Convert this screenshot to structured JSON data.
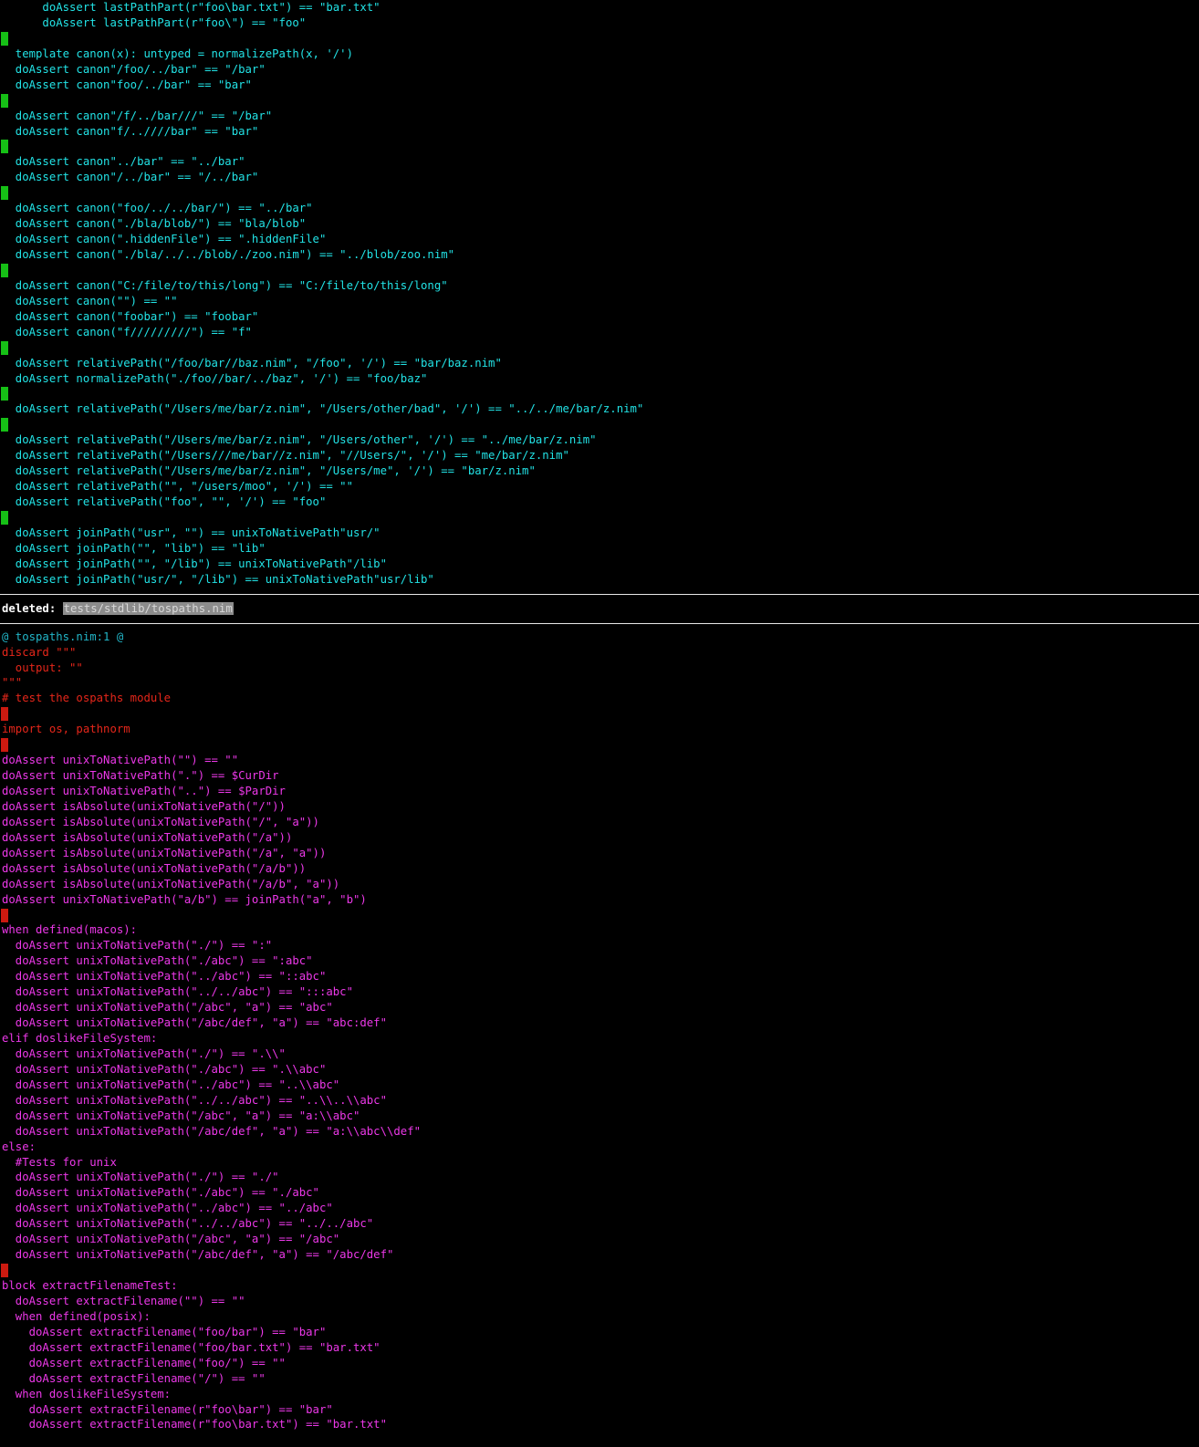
{
  "colors": {
    "background": "#000000",
    "added_text": "#22e3e6",
    "deleted_text": "#ec38e8",
    "deleted_context_text": "#e5261a",
    "hunk_header": "#22b6c8",
    "added_marker": "#16c016",
    "deleted_marker": "#cc1a10"
  },
  "added_block": {
    "lines": [
      {
        "type": "code",
        "text": "      doAssert lastPathPart(r\"foo\\bar.txt\") == \"bar.txt\""
      },
      {
        "type": "code",
        "text": "      doAssert lastPathPart(r\"foo\\\") == \"foo\""
      },
      {
        "type": "blank"
      },
      {
        "type": "code",
        "text": "  template canon(x): untyped = normalizePath(x, '/')"
      },
      {
        "type": "code",
        "text": "  doAssert canon\"/foo/../bar\" == \"/bar\""
      },
      {
        "type": "code",
        "text": "  doAssert canon\"foo/../bar\" == \"bar\""
      },
      {
        "type": "blank"
      },
      {
        "type": "code",
        "text": "  doAssert canon\"/f/../bar///\" == \"/bar\""
      },
      {
        "type": "code",
        "text": "  doAssert canon\"f/..////bar\" == \"bar\""
      },
      {
        "type": "blank"
      },
      {
        "type": "code",
        "text": "  doAssert canon\"../bar\" == \"../bar\""
      },
      {
        "type": "code",
        "text": "  doAssert canon\"/../bar\" == \"/../bar\""
      },
      {
        "type": "blank"
      },
      {
        "type": "code",
        "text": "  doAssert canon(\"foo/../../bar/\") == \"../bar\""
      },
      {
        "type": "code",
        "text": "  doAssert canon(\"./bla/blob/\") == \"bla/blob\""
      },
      {
        "type": "code",
        "text": "  doAssert canon(\".hiddenFile\") == \".hiddenFile\""
      },
      {
        "type": "code",
        "text": "  doAssert canon(\"./bla/../../blob/./zoo.nim\") == \"../blob/zoo.nim\""
      },
      {
        "type": "blank"
      },
      {
        "type": "code",
        "text": "  doAssert canon(\"C:/file/to/this/long\") == \"C:/file/to/this/long\""
      },
      {
        "type": "code",
        "text": "  doAssert canon(\"\") == \"\""
      },
      {
        "type": "code",
        "text": "  doAssert canon(\"foobar\") == \"foobar\""
      },
      {
        "type": "code",
        "text": "  doAssert canon(\"f/////////\") == \"f\""
      },
      {
        "type": "blank"
      },
      {
        "type": "code",
        "text": "  doAssert relativePath(\"/foo/bar//baz.nim\", \"/foo\", '/') == \"bar/baz.nim\""
      },
      {
        "type": "code",
        "text": "  doAssert normalizePath(\"./foo//bar/../baz\", '/') == \"foo/baz\""
      },
      {
        "type": "blank"
      },
      {
        "type": "code",
        "text": "  doAssert relativePath(\"/Users/me/bar/z.nim\", \"/Users/other/bad\", '/') == \"../../me/bar/z.nim\""
      },
      {
        "type": "blank"
      },
      {
        "type": "code",
        "text": "  doAssert relativePath(\"/Users/me/bar/z.nim\", \"/Users/other\", '/') == \"../me/bar/z.nim\""
      },
      {
        "type": "code",
        "text": "  doAssert relativePath(\"/Users///me/bar//z.nim\", \"//Users/\", '/') == \"me/bar/z.nim\""
      },
      {
        "type": "code",
        "text": "  doAssert relativePath(\"/Users/me/bar/z.nim\", \"/Users/me\", '/') == \"bar/z.nim\""
      },
      {
        "type": "code",
        "text": "  doAssert relativePath(\"\", \"/users/moo\", '/') == \"\""
      },
      {
        "type": "code",
        "text": "  doAssert relativePath(\"foo\", \"\", '/') == \"foo\""
      },
      {
        "type": "blank"
      },
      {
        "type": "code",
        "text": "  doAssert joinPath(\"usr\", \"\") == unixToNativePath\"usr/\""
      },
      {
        "type": "code",
        "text": "  doAssert joinPath(\"\", \"lib\") == \"lib\""
      },
      {
        "type": "code",
        "text": "  doAssert joinPath(\"\", \"/lib\") == unixToNativePath\"/lib\""
      },
      {
        "type": "code",
        "text": "  doAssert joinPath(\"usr/\", \"/lib\") == unixToNativePath\"usr/lib\""
      }
    ]
  },
  "file_header": {
    "label": "deleted: ",
    "path": "tests/stdlib/tospaths.nim"
  },
  "deleted_block": {
    "hunk": "@ tospaths.nim:1 @",
    "lines": [
      {
        "type": "ctx",
        "text": "discard \"\"\""
      },
      {
        "type": "ctx",
        "text": "  output: \"\""
      },
      {
        "type": "ctx",
        "text": "\"\"\""
      },
      {
        "type": "ctx",
        "text": "# test the ospaths module"
      },
      {
        "type": "blank"
      },
      {
        "type": "ctx",
        "text": "import os, pathnorm"
      },
      {
        "type": "blank"
      },
      {
        "type": "code",
        "text": "doAssert unixToNativePath(\"\") == \"\""
      },
      {
        "type": "code",
        "text": "doAssert unixToNativePath(\".\") == $CurDir"
      },
      {
        "type": "code",
        "text": "doAssert unixToNativePath(\"..\") == $ParDir"
      },
      {
        "type": "code",
        "text": "doAssert isAbsolute(unixToNativePath(\"/\"))"
      },
      {
        "type": "code",
        "text": "doAssert isAbsolute(unixToNativePath(\"/\", \"a\"))"
      },
      {
        "type": "code",
        "text": "doAssert isAbsolute(unixToNativePath(\"/a\"))"
      },
      {
        "type": "code",
        "text": "doAssert isAbsolute(unixToNativePath(\"/a\", \"a\"))"
      },
      {
        "type": "code",
        "text": "doAssert isAbsolute(unixToNativePath(\"/a/b\"))"
      },
      {
        "type": "code",
        "text": "doAssert isAbsolute(unixToNativePath(\"/a/b\", \"a\"))"
      },
      {
        "type": "code",
        "text": "doAssert unixToNativePath(\"a/b\") == joinPath(\"a\", \"b\")"
      },
      {
        "type": "blank"
      },
      {
        "type": "code",
        "text": "when defined(macos):"
      },
      {
        "type": "code",
        "text": "  doAssert unixToNativePath(\"./\") == \":\""
      },
      {
        "type": "code",
        "text": "  doAssert unixToNativePath(\"./abc\") == \":abc\""
      },
      {
        "type": "code",
        "text": "  doAssert unixToNativePath(\"../abc\") == \"::abc\""
      },
      {
        "type": "code",
        "text": "  doAssert unixToNativePath(\"../../abc\") == \":::abc\""
      },
      {
        "type": "code",
        "text": "  doAssert unixToNativePath(\"/abc\", \"a\") == \"abc\""
      },
      {
        "type": "code",
        "text": "  doAssert unixToNativePath(\"/abc/def\", \"a\") == \"abc:def\""
      },
      {
        "type": "code",
        "text": "elif doslikeFileSystem:"
      },
      {
        "type": "code",
        "text": "  doAssert unixToNativePath(\"./\") == \".\\\\\""
      },
      {
        "type": "code",
        "text": "  doAssert unixToNativePath(\"./abc\") == \".\\\\abc\""
      },
      {
        "type": "code",
        "text": "  doAssert unixToNativePath(\"../abc\") == \"..\\\\abc\""
      },
      {
        "type": "code",
        "text": "  doAssert unixToNativePath(\"../../abc\") == \"..\\\\..\\\\abc\""
      },
      {
        "type": "code",
        "text": "  doAssert unixToNativePath(\"/abc\", \"a\") == \"a:\\\\abc\""
      },
      {
        "type": "code",
        "text": "  doAssert unixToNativePath(\"/abc/def\", \"a\") == \"a:\\\\abc\\\\def\""
      },
      {
        "type": "code",
        "text": "else:"
      },
      {
        "type": "code",
        "text": "  #Tests for unix"
      },
      {
        "type": "code",
        "text": "  doAssert unixToNativePath(\"./\") == \"./\""
      },
      {
        "type": "code",
        "text": "  doAssert unixToNativePath(\"./abc\") == \"./abc\""
      },
      {
        "type": "code",
        "text": "  doAssert unixToNativePath(\"../abc\") == \"../abc\""
      },
      {
        "type": "code",
        "text": "  doAssert unixToNativePath(\"../../abc\") == \"../../abc\""
      },
      {
        "type": "code",
        "text": "  doAssert unixToNativePath(\"/abc\", \"a\") == \"/abc\""
      },
      {
        "type": "code",
        "text": "  doAssert unixToNativePath(\"/abc/def\", \"a\") == \"/abc/def\""
      },
      {
        "type": "blank"
      },
      {
        "type": "code",
        "text": "block extractFilenameTest:"
      },
      {
        "type": "code",
        "text": "  doAssert extractFilename(\"\") == \"\""
      },
      {
        "type": "code",
        "text": "  when defined(posix):"
      },
      {
        "type": "code",
        "text": "    doAssert extractFilename(\"foo/bar\") == \"bar\""
      },
      {
        "type": "code",
        "text": "    doAssert extractFilename(\"foo/bar.txt\") == \"bar.txt\""
      },
      {
        "type": "code",
        "text": "    doAssert extractFilename(\"foo/\") == \"\""
      },
      {
        "type": "code",
        "text": "    doAssert extractFilename(\"/\") == \"\""
      },
      {
        "type": "code",
        "text": "  when doslikeFileSystem:"
      },
      {
        "type": "code",
        "text": "    doAssert extractFilename(r\"foo\\bar\") == \"bar\""
      },
      {
        "type": "code",
        "text": "    doAssert extractFilename(r\"foo\\bar.txt\") == \"bar.txt\""
      }
    ]
  }
}
